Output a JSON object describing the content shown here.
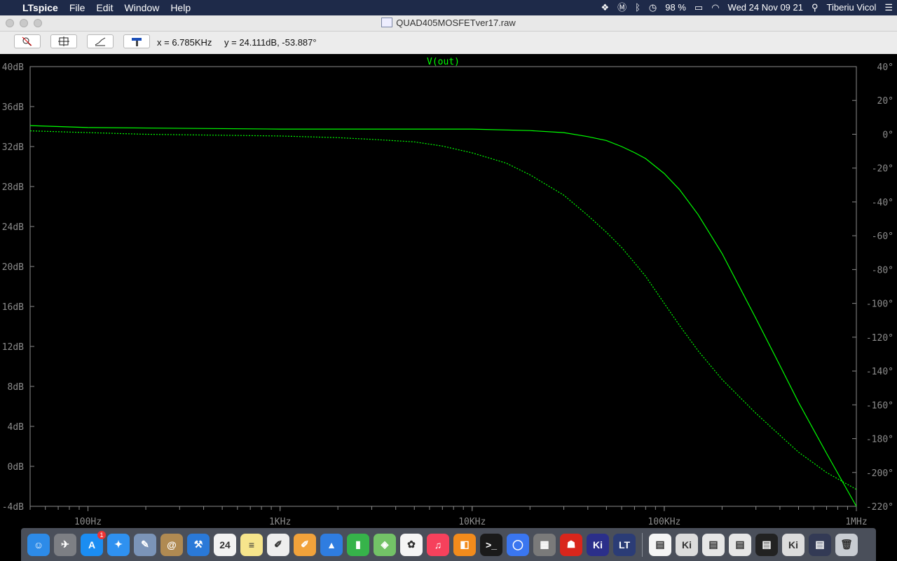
{
  "menubar": {
    "app_name": "LTspice",
    "menus": [
      "File",
      "Edit",
      "Window",
      "Help"
    ],
    "battery": "98 %",
    "datetime": "Wed 24 Nov  09 21",
    "user": "Tiberiu Vicol"
  },
  "window": {
    "title": "QUAD405MOSFETver17.raw"
  },
  "toolbar": {
    "x_readout": "x = 6.785KHz",
    "y_readout": "y = 24.111dB, -53.887°"
  },
  "chart_data": {
    "type": "line",
    "title": "V(out)",
    "x_scale": "log",
    "xlim": [
      50,
      1000000
    ],
    "x_ticks": [
      {
        "value": 100,
        "label": "100Hz"
      },
      {
        "value": 1000,
        "label": "1KHz"
      },
      {
        "value": 10000,
        "label": "10KHz"
      },
      {
        "value": 100000,
        "label": "100KHz"
      },
      {
        "value": 1000000,
        "label": "1MHz"
      }
    ],
    "y_left": {
      "lim": [
        -4,
        40
      ],
      "ticks": [
        "40dB",
        "36dB",
        "32dB",
        "28dB",
        "24dB",
        "20dB",
        "16dB",
        "12dB",
        "8dB",
        "4dB",
        "0dB",
        "-4dB"
      ]
    },
    "y_right": {
      "lim": [
        -220,
        40
      ],
      "ticks": [
        "40°",
        "20°",
        "0°",
        "-20°",
        "-40°",
        "-60°",
        "-80°",
        "-100°",
        "-120°",
        "-140°",
        "-160°",
        "-180°",
        "-200°",
        "-220°"
      ]
    },
    "colors": {
      "magnitude": "#00ff00",
      "phase": "#00ff00",
      "axis": "#8c8c8c",
      "text": "#8c8c8c",
      "title": "#00ff00"
    },
    "series": [
      {
        "kind": "magnitude",
        "axis": "left",
        "style": "solid",
        "points": [
          [
            50,
            34.1
          ],
          [
            100,
            33.9
          ],
          [
            1000,
            33.75
          ],
          [
            10000,
            33.75
          ],
          [
            20000,
            33.6
          ],
          [
            30000,
            33.4
          ],
          [
            40000,
            33.0
          ],
          [
            50000,
            32.6
          ],
          [
            60000,
            32.0
          ],
          [
            70000,
            31.4
          ],
          [
            80000,
            30.8
          ],
          [
            100000,
            29.3
          ],
          [
            120000,
            27.7
          ],
          [
            150000,
            25.2
          ],
          [
            200000,
            21.3
          ],
          [
            300000,
            14.8
          ],
          [
            400000,
            10.1
          ],
          [
            500000,
            6.4
          ],
          [
            700000,
            1.3
          ],
          [
            1000000,
            -4.0
          ]
        ]
      },
      {
        "kind": "phase",
        "axis": "right",
        "style": "dotted",
        "points": [
          [
            50,
            2
          ],
          [
            100,
            1
          ],
          [
            200,
            0
          ],
          [
            1000,
            -1
          ],
          [
            2000,
            -2
          ],
          [
            3000,
            -3
          ],
          [
            5000,
            -4.5
          ],
          [
            7000,
            -7
          ],
          [
            10000,
            -11
          ],
          [
            15000,
            -17
          ],
          [
            20000,
            -24
          ],
          [
            30000,
            -36
          ],
          [
            40000,
            -48
          ],
          [
            50000,
            -58
          ],
          [
            60000,
            -67
          ],
          [
            70000,
            -76
          ],
          [
            80000,
            -84
          ],
          [
            100000,
            -100
          ],
          [
            120000,
            -113
          ],
          [
            150000,
            -128
          ],
          [
            200000,
            -145
          ],
          [
            300000,
            -165
          ],
          [
            400000,
            -178
          ],
          [
            500000,
            -188
          ],
          [
            700000,
            -200
          ],
          [
            1000000,
            -210
          ]
        ]
      }
    ]
  },
  "dock": {
    "apps": [
      {
        "name": "finder-icon",
        "glyph": "☺",
        "color": "#2d8be8"
      },
      {
        "name": "launchpad-icon",
        "glyph": "✈",
        "color": "#7d7f84"
      },
      {
        "name": "app-store-icon",
        "glyph": "A",
        "color": "#1b8df2",
        "badge": "1"
      },
      {
        "name": "safari-icon",
        "glyph": "✦",
        "color": "#2f91f0"
      },
      {
        "name": "preview-icon",
        "glyph": "✎",
        "color": "#7b94b8"
      },
      {
        "name": "contacts-icon",
        "glyph": "@",
        "color": "#b08a52"
      },
      {
        "name": "xcode-icon",
        "glyph": "⚒",
        "color": "#2a79d8"
      },
      {
        "name": "calendar-icon",
        "glyph": "24",
        "color": "#f2f2f2"
      },
      {
        "name": "notes-icon",
        "glyph": "≡",
        "color": "#f6e58c"
      },
      {
        "name": "textedit-icon",
        "glyph": "✐",
        "color": "#eeeeee"
      },
      {
        "name": "pages-icon",
        "glyph": "✐",
        "color": "#f1a23b"
      },
      {
        "name": "keynote-icon",
        "glyph": "▲",
        "color": "#2f7de0"
      },
      {
        "name": "numbers-icon",
        "glyph": "▮",
        "color": "#36b34a"
      },
      {
        "name": "maps-icon",
        "glyph": "◈",
        "color": "#73c267"
      },
      {
        "name": "photos-icon",
        "glyph": "✿",
        "color": "#f5f5f5"
      },
      {
        "name": "music-icon",
        "glyph": "♫",
        "color": "#f6415c"
      },
      {
        "name": "books-icon",
        "glyph": "◧",
        "color": "#f28b1c"
      },
      {
        "name": "terminal-icon",
        "glyph": ">_",
        "color": "#1a1a1a"
      },
      {
        "name": "signal-icon",
        "glyph": "◯",
        "color": "#3a76f0"
      },
      {
        "name": "calculator-icon",
        "glyph": "▦",
        "color": "#7a7a7a"
      },
      {
        "name": "acrobat-icon",
        "glyph": "☗",
        "color": "#d9261c"
      },
      {
        "name": "kicad-icon",
        "glyph": "Ki",
        "color": "#2b2f8a"
      },
      {
        "name": "ltspice-icon",
        "glyph": "LT",
        "color": "#2b3c76"
      }
    ],
    "docs": [
      {
        "name": "document-thumb-icon",
        "glyph": "▤",
        "color": "#f5f5f5"
      },
      {
        "name": "kicad-window-thumb-icon",
        "glyph": "Ki",
        "color": "#dcdcdc"
      },
      {
        "name": "pdf-window-thumb-icon",
        "glyph": "▤",
        "color": "#e6e6e6"
      },
      {
        "name": "screenshot-thumb-icon",
        "glyph": "▤",
        "color": "#e6e6e6"
      },
      {
        "name": "ltspice-window-thumb-icon",
        "glyph": "▤",
        "color": "#222222"
      },
      {
        "name": "kicad-window-thumb-2-icon",
        "glyph": "Ki",
        "color": "#dcdcdc"
      },
      {
        "name": "screen-thumb-icon",
        "glyph": "▤",
        "color": "#333a55"
      },
      {
        "name": "trash-icon",
        "glyph": "🗑",
        "color": "#c8ccd2"
      }
    ]
  }
}
